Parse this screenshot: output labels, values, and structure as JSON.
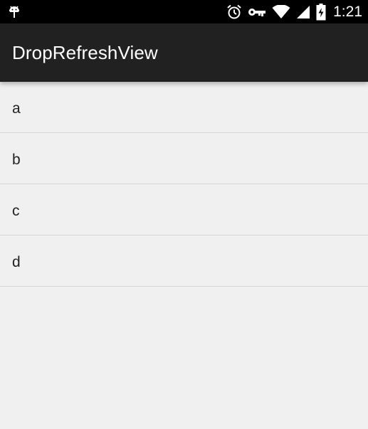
{
  "status_bar": {
    "time": "1:21",
    "icons": [
      "android-debug-icon",
      "alarm-clock-icon",
      "key-icon",
      "wifi-icon",
      "cell-signal-icon",
      "battery-charging-icon"
    ]
  },
  "app_bar": {
    "title": "DropRefreshView",
    "background": "#212121"
  },
  "list": {
    "items": [
      {
        "label": "a"
      },
      {
        "label": "b"
      },
      {
        "label": "c"
      },
      {
        "label": "d"
      }
    ]
  }
}
